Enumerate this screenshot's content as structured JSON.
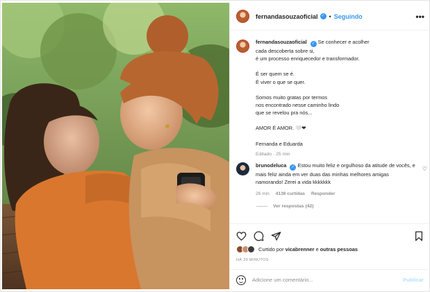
{
  "header": {
    "username": "fernandasouzaoficial",
    "separator": "•",
    "follow_label": "Seguindo",
    "more_label": "•••",
    "avatar_icon": "profile-avatar"
  },
  "caption": {
    "username": "fernandasouzaoficial",
    "lines": [
      "Se conhecer e acolher",
      "cada descoberta sobre si,",
      "é um processo enriquecedor e transformador.",
      "",
      "É ser quem se é.",
      "É viver o que se quer.",
      "",
      "Somos muito gratas por termos",
      "nos encontrado nesse caminho lindo",
      "que se revelou pra nós...",
      "",
      "AMOR É AMOR. 🤍❤",
      "",
      "Fernanda e Eduarda"
    ],
    "meta": "Editado · 25 min"
  },
  "comment": {
    "username": "brunodeluca",
    "text": "Estou muito feliz e orgulhoso da atitude de vocês, e mais feliz ainda em ver duas das minhas melhores amigas namorando! Zerei a vida kkkkkkk",
    "time": "26 min",
    "likes": "4136 curtidas",
    "reply_label": "Responder",
    "view_replies": "Ver respostas (42)",
    "like_icon": "heart-outline-icon"
  },
  "actions": {
    "icons": [
      "heart-icon",
      "comment-icon",
      "share-icon",
      "bookmark-icon"
    ]
  },
  "likes": {
    "prefix": "Curtido por",
    "user": "vicabrenner",
    "suffix": "e",
    "others": "outras pessoas"
  },
  "timestamp": "HÁ 29 MINUTOS",
  "add_comment": {
    "placeholder": "Adicione um comentário...",
    "publish_label": "Publicar",
    "emoji_icon": "emoji-icon"
  },
  "colors": {
    "link_blue": "#3897f0",
    "publish_disabled": "#b2dffc",
    "text": "#262626",
    "muted": "#8e8e8e",
    "border": "#efefef"
  }
}
